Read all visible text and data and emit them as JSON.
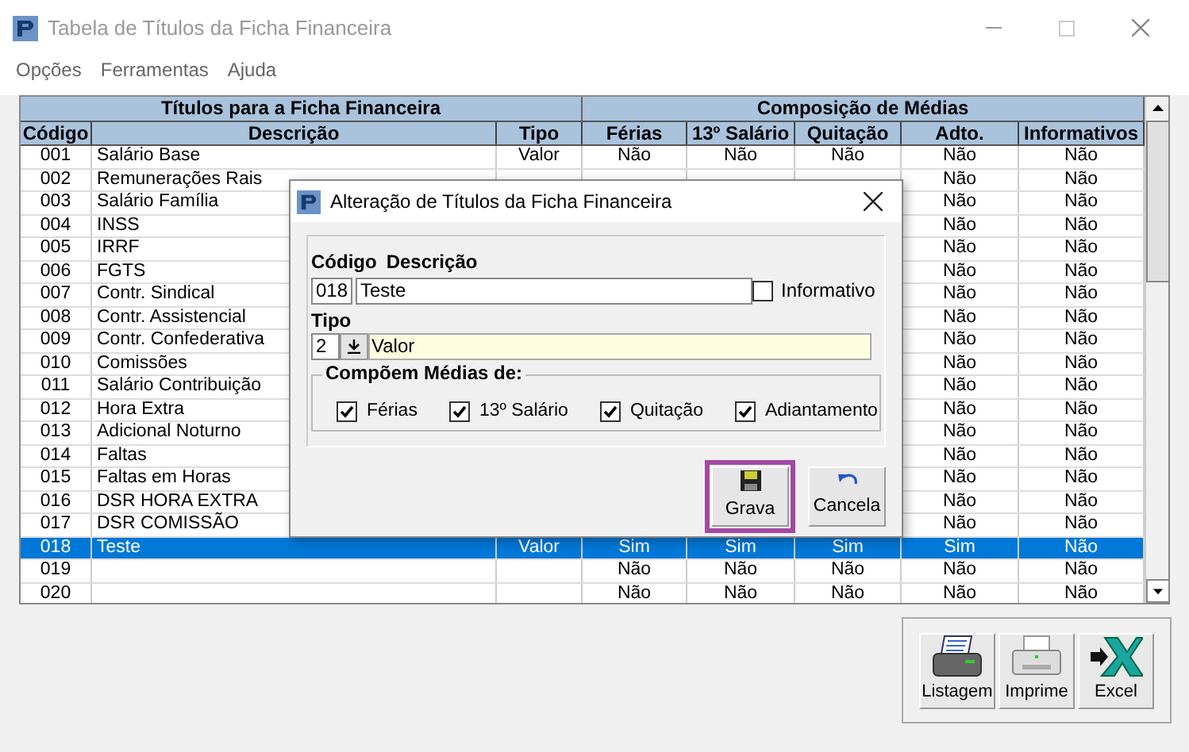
{
  "window": {
    "title": "Tabela de Títulos da Ficha Financeira"
  },
  "menu": [
    "Opções",
    "Ferramentas",
    "Ajuda"
  ],
  "table": {
    "groups": [
      "Títulos para a Ficha Financeira",
      "Composição de Médias"
    ],
    "columns": [
      "Código",
      "Descrição",
      "Tipo",
      "Férias",
      "13º Salário",
      "Quitação",
      "Adto.",
      "Informativos"
    ],
    "rows": [
      {
        "selected": false,
        "cells": [
          "001",
          "Salário Base",
          "Valor",
          "Não",
          "Não",
          "Não",
          "Não",
          "Não"
        ]
      },
      {
        "selected": false,
        "cells": [
          "002",
          "Remunerações Rais",
          null,
          null,
          null,
          null,
          "Não",
          "Não"
        ]
      },
      {
        "selected": false,
        "cells": [
          "003",
          "Salário Família",
          null,
          null,
          null,
          null,
          "Não",
          "Não"
        ]
      },
      {
        "selected": false,
        "cells": [
          "004",
          "INSS",
          null,
          null,
          null,
          null,
          "Não",
          "Não"
        ]
      },
      {
        "selected": false,
        "cells": [
          "005",
          "IRRF",
          null,
          null,
          null,
          null,
          "Não",
          "Não"
        ]
      },
      {
        "selected": false,
        "cells": [
          "006",
          "FGTS",
          null,
          null,
          null,
          null,
          "Não",
          "Não"
        ]
      },
      {
        "selected": false,
        "cells": [
          "007",
          "Contr. Sindical",
          null,
          null,
          null,
          null,
          "Não",
          "Não"
        ]
      },
      {
        "selected": false,
        "cells": [
          "008",
          "Contr. Assistencial",
          null,
          null,
          null,
          null,
          "Não",
          "Não"
        ]
      },
      {
        "selected": false,
        "cells": [
          "009",
          "Contr. Confederativa",
          null,
          null,
          null,
          null,
          "Não",
          "Não"
        ]
      },
      {
        "selected": false,
        "cells": [
          "010",
          "Comissões",
          null,
          null,
          null,
          null,
          "Não",
          "Não"
        ]
      },
      {
        "selected": false,
        "cells": [
          "011",
          "Salário Contribuição",
          null,
          null,
          null,
          null,
          "Não",
          "Não"
        ]
      },
      {
        "selected": false,
        "cells": [
          "012",
          "Hora Extra",
          null,
          null,
          null,
          null,
          "Não",
          "Não"
        ]
      },
      {
        "selected": false,
        "cells": [
          "013",
          "Adicional Noturno",
          null,
          null,
          null,
          null,
          "Não",
          "Não"
        ]
      },
      {
        "selected": false,
        "cells": [
          "014",
          "Faltas",
          null,
          null,
          null,
          null,
          "Não",
          "Não"
        ]
      },
      {
        "selected": false,
        "cells": [
          "015",
          "Faltas em Horas",
          null,
          null,
          null,
          null,
          "Não",
          "Não"
        ]
      },
      {
        "selected": false,
        "cells": [
          "016",
          "DSR HORA EXTRA",
          null,
          null,
          null,
          null,
          "Não",
          "Não"
        ]
      },
      {
        "selected": false,
        "cells": [
          "017",
          "DSR COMISSÃO",
          null,
          null,
          null,
          null,
          "Não",
          "Não"
        ]
      },
      {
        "selected": true,
        "cells": [
          "018",
          "Teste",
          "Valor",
          "Sim",
          "Sim",
          "Sim",
          "Sim",
          "Não"
        ]
      },
      {
        "selected": false,
        "cells": [
          "019",
          null,
          null,
          "Não",
          "Não",
          "Não",
          "Não",
          "Não"
        ]
      },
      {
        "selected": false,
        "cells": [
          "020",
          null,
          null,
          "Não",
          "Não",
          "Não",
          "Não",
          "Não"
        ]
      }
    ]
  },
  "dialog": {
    "title": "Alteração de Títulos da Ficha Financeira",
    "code_label": "Código",
    "description_label": "Descrição",
    "code": "018",
    "description": "Teste",
    "informativo": {
      "label": "Informativo",
      "checked": false
    },
    "tipo_label": "Tipo",
    "tipo_code": "2",
    "tipo_value": "Valor",
    "group_legend": "Compõem Médias de:",
    "checkboxes": [
      {
        "label": "Férias",
        "checked": true
      },
      {
        "label": "13º Salário",
        "checked": true
      },
      {
        "label": "Quitação",
        "checked": true
      },
      {
        "label": "Adiantamento",
        "checked": true
      }
    ],
    "buttons": [
      {
        "label": "Grava",
        "kind": "save",
        "focused": true
      },
      {
        "label": "Cancela",
        "kind": "undo",
        "focused": false
      }
    ]
  },
  "toolbar": [
    {
      "label": "Listagem",
      "kind": "printer"
    },
    {
      "label": "Imprime",
      "kind": "inkjet"
    },
    {
      "label": "Excel",
      "kind": "excel"
    }
  ]
}
